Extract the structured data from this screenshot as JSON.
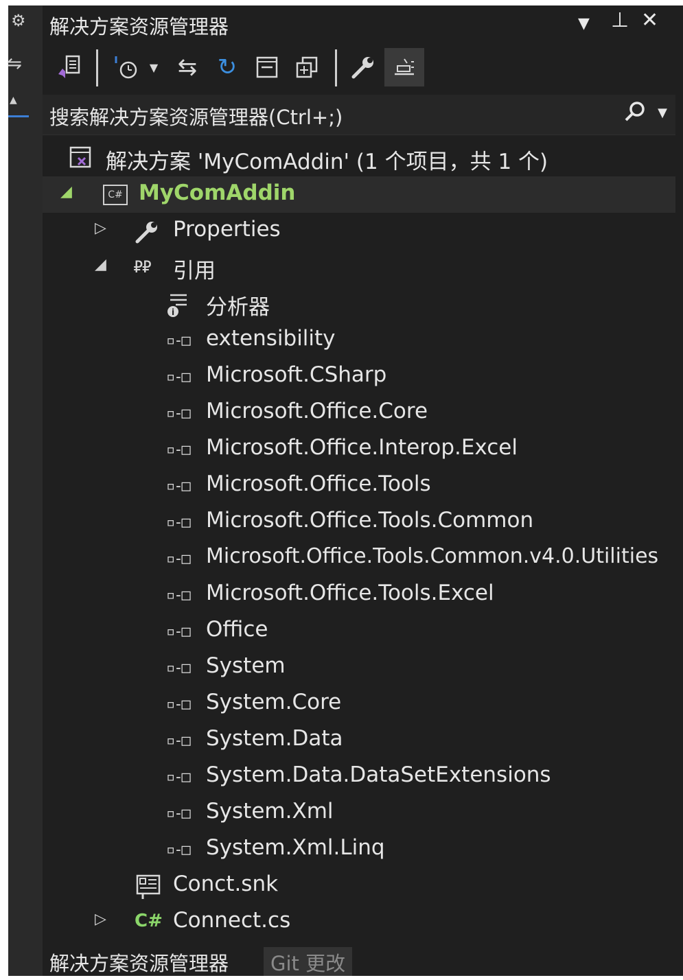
{
  "window": {
    "title": "解决方案资源管理器"
  },
  "search": {
    "placeholder": "搜索解决方案资源管理器(Ctrl+;)"
  },
  "tree": {
    "solution": "解决方案 'MyComAddin' (1 个项目，共 1 个)",
    "project": "MyComAddin",
    "properties": "Properties",
    "references": "引用",
    "analyzers": "分析器",
    "refs": [
      "extensibility",
      "Microsoft.CSharp",
      "Microsoft.Office.Core",
      "Microsoft.Office.Interop.Excel",
      "Microsoft.Office.Tools",
      "Microsoft.Office.Tools.Common",
      "Microsoft.Office.Tools.Common.v4.0.Utilities",
      "Microsoft.Office.Tools.Excel",
      "Office",
      "System",
      "System.Core",
      "System.Data",
      "System.Data.DataSetExtensions",
      "System.Xml",
      "System.Xml.Linq"
    ],
    "snk": "Conct.snk",
    "cs_file": "Connect.cs"
  },
  "bottom_tabs": [
    {
      "label": "解决方案资源管理器"
    },
    {
      "label": "Git 更改"
    }
  ],
  "colors": {
    "background": "#1f1f1f",
    "project_green": "#9fd66a",
    "accent_blue": "#3c7fd6"
  }
}
